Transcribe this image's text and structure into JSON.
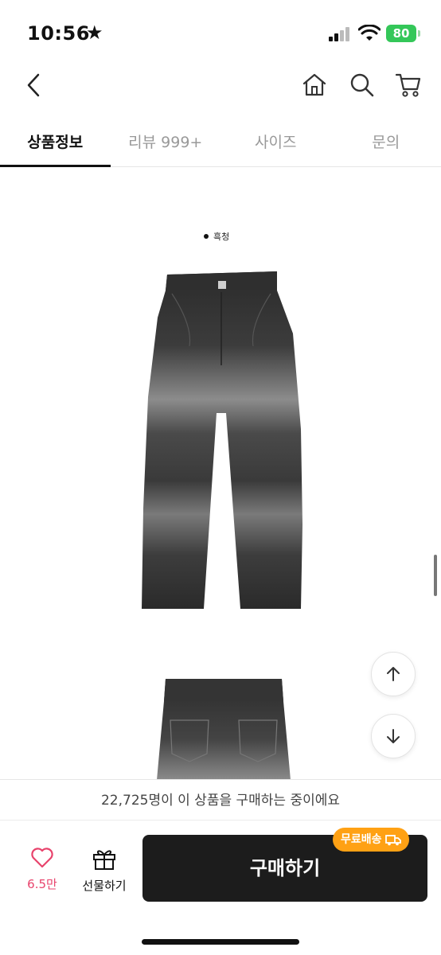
{
  "status": {
    "time": "10:56",
    "star": "★",
    "battery": "80"
  },
  "nav": {
    "icons": [
      "back-icon",
      "home-icon",
      "search-icon",
      "cart-icon"
    ]
  },
  "tabs": [
    {
      "label": "상품정보",
      "active": true
    },
    {
      "label": "리뷰 999+",
      "active": false
    },
    {
      "label": "사이즈",
      "active": false
    },
    {
      "label": "문의",
      "active": false
    }
  ],
  "content": {
    "color_label": "흑청"
  },
  "notice": {
    "text": "22,725명이 이 상품을 구매하는 중이에요"
  },
  "bottom": {
    "like_count": "6.5만",
    "gift_label": "선물하기",
    "buy_label": "구매하기",
    "free_shipping": "무료배송"
  },
  "colors": {
    "accent_like": "#e8436c",
    "buy_button": "#1c1c1c",
    "free_shipping_badge": "#ffa114",
    "battery": "#34c759"
  }
}
